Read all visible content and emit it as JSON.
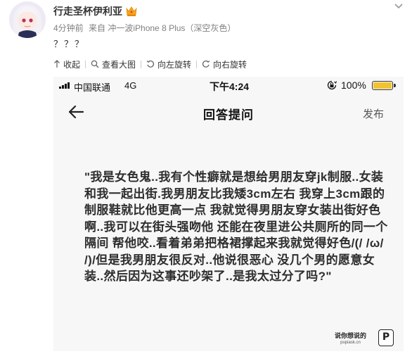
{
  "post": {
    "username": "行走圣杯伊利亚",
    "time": "4分钟前",
    "source": "来自 冲一波iPhone 8 Plus（深空灰色）",
    "text": "？？？",
    "vip_badge": "crown-badge-icon"
  },
  "toolbar": {
    "items": [
      {
        "label": "收起",
        "icon": "arrow-up-icon"
      },
      {
        "label": "查看大图",
        "icon": "zoom-icon"
      },
      {
        "label": "向左旋转",
        "icon": "rotate-left-icon"
      },
      {
        "label": "向右旋转",
        "icon": "rotate-right-icon"
      }
    ]
  },
  "phone": {
    "status": {
      "carrier": "中国联通",
      "network": "4G",
      "time": "下午4:24",
      "battery": "100%",
      "battery_color": "#f2c230"
    },
    "nav": {
      "title": "回答提问",
      "publish": "发布"
    },
    "question": "\"我是女色鬼..我有个性癖就是想给男朋友穿jk制服..女装和我一起出街.我男朋友比我矮3cm左右 我穿上3cm跟的制服鞋就比他更高一点 我就觉得男朋友穿女装出街好色啊..我可以在街头强吻他 还能在夜里进公共厕所的同一个隔间 帮他咬..看着弟弟把格裙撑起来我就觉得好色/(/ /ω/ /)/但是我男朋友很反对..他说很恶心 没几个男的愿意女装..然后因为这事还吵架了..是我太过分了吗?\"",
    "watermark": {
      "text": "说你想说的",
      "url": "popiask.cn",
      "logo": "P"
    }
  }
}
